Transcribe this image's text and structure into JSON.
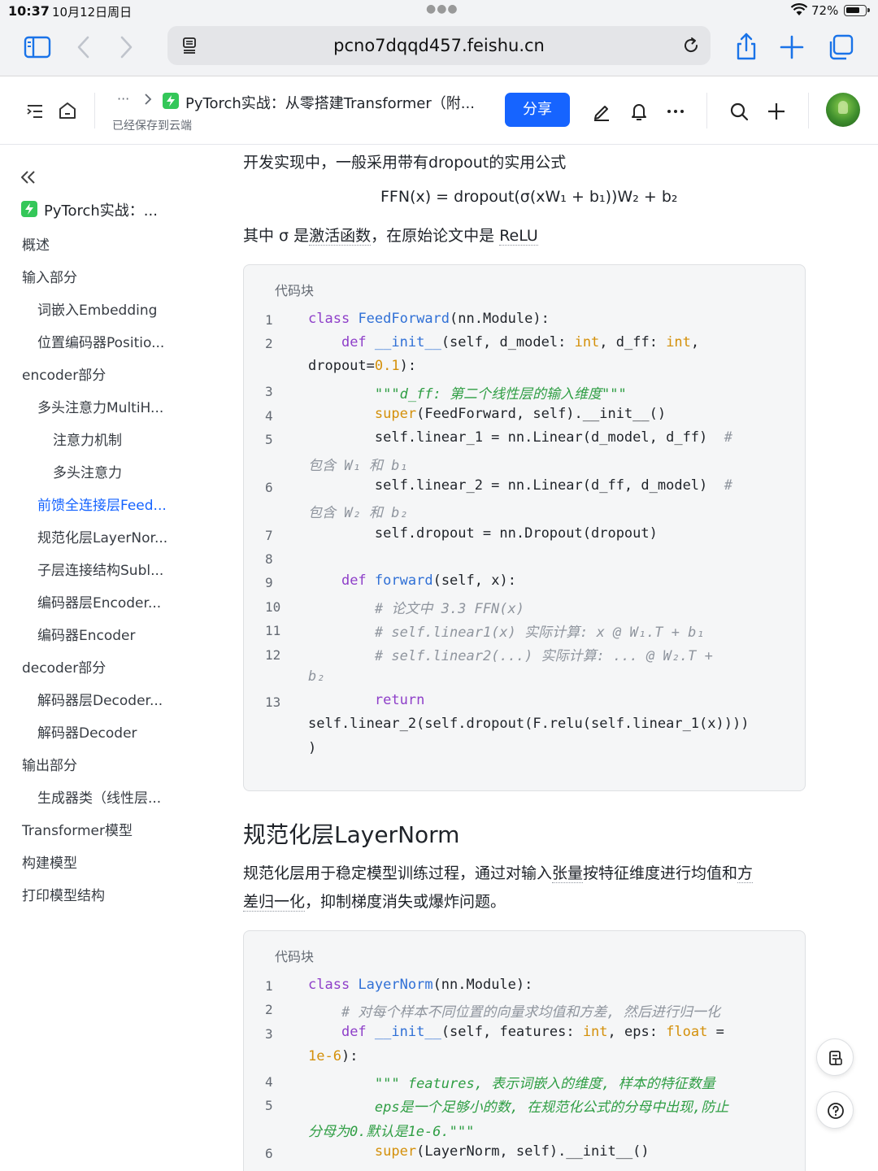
{
  "status_bar": {
    "time": "10:37",
    "date": "10月12日周日",
    "battery": "72%"
  },
  "browser": {
    "url": "pcno7dqqd457.feishu.cn"
  },
  "header": {
    "breadcrumb_more": "···",
    "doc_title": "PyTorch实战：从零搭建Transformer（附...",
    "saved_status": "已经保存到云端",
    "share_label": "分享",
    "more_label": "···"
  },
  "sidebar": {
    "root": "PyTorch实战：...",
    "items": [
      {
        "label": "概述",
        "level": 1
      },
      {
        "label": "输入部分",
        "level": 1
      },
      {
        "label": "词嵌入Embedding",
        "level": 2
      },
      {
        "label": "位置编码器Positio...",
        "level": 2
      },
      {
        "label": "encoder部分",
        "level": 1
      },
      {
        "label": "多头注意力MultiH...",
        "level": 2
      },
      {
        "label": "注意力机制",
        "level": 3
      },
      {
        "label": "多头注意力",
        "level": 3
      },
      {
        "label": "前馈全连接层Feed...",
        "level": 2,
        "active": true
      },
      {
        "label": "规范化层LayerNor...",
        "level": 2
      },
      {
        "label": "子层连接结构Subl...",
        "level": 2
      },
      {
        "label": "编码器层Encoder...",
        "level": 2
      },
      {
        "label": "编码器Encoder",
        "level": 2
      },
      {
        "label": "decoder部分",
        "level": 1
      },
      {
        "label": "解码器层Decoder...",
        "level": 2
      },
      {
        "label": "解码器Decoder",
        "level": 2
      },
      {
        "label": "输出部分",
        "level": 1
      },
      {
        "label": "生成器类（线性层...",
        "level": 2
      },
      {
        "label": "Transformer模型",
        "level": 1
      },
      {
        "label": "构建模型",
        "level": 1
      },
      {
        "label": "打印模型结构",
        "level": 1
      }
    ]
  },
  "content": {
    "para1": "开发实现中，一般采用带有dropout的实用公式",
    "formula": "FFN(x) = dropout(σ(xW₁ + b₁))W₂ + b₂",
    "para2_prefix": "其中 σ 是",
    "para2_link1": "激活函数",
    "para2_mid": "，在原始论文中是 ",
    "para2_link2": "ReLU",
    "code_label_1": "代码块",
    "code1_line_numbers": [
      "1",
      "2",
      "",
      "3",
      "4",
      "5",
      "",
      "6",
      "",
      "7",
      "8",
      "9",
      "10",
      "11",
      "12",
      "",
      "13",
      "",
      ""
    ],
    "heading": "规范化层LayerNorm",
    "para3_prefix": "规范化层用于稳定模型训练过程，通过对输入",
    "para3_link1": "张量",
    "para3_mid": "按特征维度进行均值和",
    "para3_link2a": "方",
    "para3_link2b": "差归一化",
    "para3_suffix": "，抑制梯度消失或爆炸问题。",
    "code_label_2": "代码块",
    "code2_line_numbers": [
      "1",
      "2",
      "3",
      "",
      "4",
      "5",
      "",
      "6"
    ]
  },
  "colors": {
    "accent": "#1664ff",
    "keyword": "#8e3fc9",
    "function": "#3070d6",
    "type": "#d4900a",
    "comment": "#8f959e",
    "string": "#2f9e44"
  }
}
